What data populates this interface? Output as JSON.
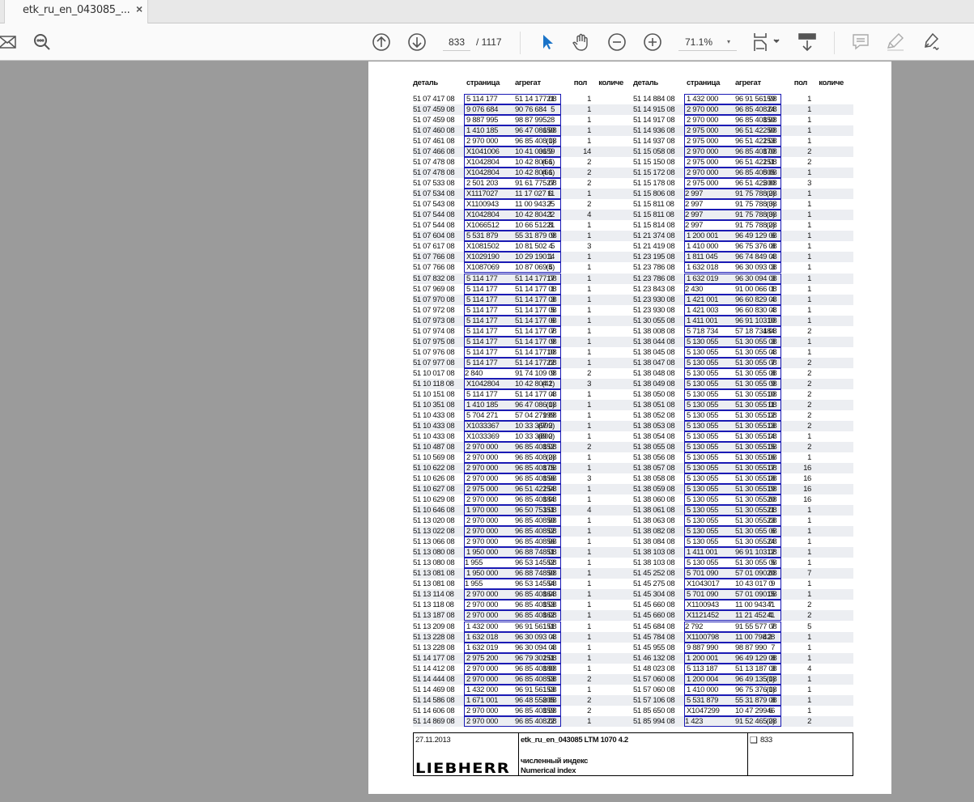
{
  "tab": {
    "title": "etk_ru_en_043085_...",
    "close": "×"
  },
  "toolbar": {
    "page_current": "833",
    "page_total": "/ 1117",
    "zoom": "71.1%",
    "zoom_dropdown": "▾",
    "icons": [
      "mail-icon",
      "search-icon",
      "page-up-icon",
      "page-down-icon",
      "select-cursor-icon",
      "hand-icon",
      "zoom-out-icon",
      "zoom-in-icon",
      "fit-page-icon",
      "scroll-mode-icon",
      "comment-icon",
      "highlight-icon",
      "sign-icon"
    ]
  },
  "colors": {
    "accent": "#1a73c8",
    "box": "#1a1ab4",
    "row_shade": "#eceef2"
  },
  "table": {
    "headers": [
      "деталь",
      "страница",
      "агрегат",
      "пол",
      "количе"
    ],
    "left": [
      [
        "51 07 417 08",
        "5 114 177",
        "51 14 177 08",
        "21",
        "1"
      ],
      [
        "51 07 459 08",
        "9 076 684",
        "90 76 684",
        "5",
        "1"
      ],
      [
        "51 07 459 08",
        "9 887 995",
        "98 87 995",
        "28",
        "1"
      ],
      [
        "51 07 460 08",
        "1 410 185",
        "96 47 086 08",
        "150",
        "1"
      ],
      [
        "51 07 461 08",
        "2 970 000",
        "96 85 408 08",
        "(1)",
        "1"
      ],
      [
        "51 07 466 08",
        "X1041006",
        "10 41 006 9",
        "3159",
        "14"
      ],
      [
        "51 07 478 08",
        "X1042804",
        "10 42 804 1",
        "(66)",
        "2"
      ],
      [
        "51 07 478 08",
        "X1042804",
        "10 42 804 1",
        "(66)",
        "2"
      ],
      [
        "51 07 533 08",
        "2 501 203",
        "91 61 775 08",
        "27",
        "2"
      ],
      [
        "51 07 534 08",
        "X1117027",
        "11 17 027 6",
        "11",
        "1"
      ],
      [
        "51 07 543 08",
        "X1100943",
        "11 00 943 7",
        "25",
        "2"
      ],
      [
        "51 07 544 08",
        "X1042804",
        "10 42 804 1",
        "22",
        "4"
      ],
      [
        "51 07 544 08",
        "X1066512",
        "10 66 512 8",
        "21",
        "1"
      ],
      [
        "51 07 604 08",
        "5 531 879",
        "55 31 879 08",
        "9",
        "1"
      ],
      [
        "51 07 617 08",
        "X1081502",
        "10 81 502 4",
        "5",
        "3"
      ],
      [
        "51 07 766 08",
        "X1029190",
        "10 29 190 1",
        "14",
        "1"
      ],
      [
        "51 07 766 08",
        "X1087069",
        "10 87 069 4",
        "(5)",
        "1"
      ],
      [
        "51 07 832 08",
        "5 114 177",
        "51 14 177 08",
        "17",
        "1"
      ],
      [
        "51 07 969 08",
        "5 114 177",
        "51 14 177 08",
        "1",
        "1"
      ],
      [
        "51 07 970 08",
        "5 114 177",
        "51 14 177 08",
        "3",
        "1"
      ],
      [
        "51 07 972 08",
        "5 114 177",
        "51 14 177 08",
        "5",
        "1"
      ],
      [
        "51 07 973 08",
        "5 114 177",
        "51 14 177 08",
        "6",
        "1"
      ],
      [
        "51 07 974 08",
        "5 114 177",
        "51 14 177 08",
        "7",
        "1"
      ],
      [
        "51 07 975 08",
        "5 114 177",
        "51 14 177 08",
        "9",
        "1"
      ],
      [
        "51 07 976 08",
        "5 114 177",
        "51 14 177 08",
        "10",
        "1"
      ],
      [
        "51 07 977 08",
        "5 114 177",
        "51 14 177 08",
        "22",
        "1"
      ],
      [
        "51 10 017 08",
        "2 840",
        "91 74 109 08",
        "9",
        "2"
      ],
      [
        "51 10 118 08",
        "X1042804",
        "10 42 804 1",
        "(42)",
        "3"
      ],
      [
        "51 10 151 08",
        "5 114 177",
        "51 14 177 08",
        "4",
        "1"
      ],
      [
        "51 10 351 08",
        "1 410 185",
        "96 47 086 08",
        "(1)",
        "1"
      ],
      [
        "51 10 433 08",
        "5 704 271",
        "57 04 271 08",
        "999",
        "1"
      ],
      [
        "51 10 433 08",
        "X1033367",
        "10 33 367 2",
        "(999)",
        "1"
      ],
      [
        "51 10 433 08",
        "X1033369",
        "10 33 369 2",
        "(800)",
        "1"
      ],
      [
        "51 10 487 08",
        "2 970 000",
        "96 85 408 08",
        "152",
        "2"
      ],
      [
        "51 10 569 08",
        "2 970 000",
        "96 85 408 08",
        "(2)",
        "1"
      ],
      [
        "51 10 622 08",
        "2 970 000",
        "96 85 408 08",
        "175",
        "1"
      ],
      [
        "51 10 626 08",
        "2 970 000",
        "96 85 408 08",
        "156",
        "3"
      ],
      [
        "51 10 627 08",
        "2 975 000",
        "96 51 422 08",
        "154",
        "1"
      ],
      [
        "51 10 629 08",
        "2 970 000",
        "96 85 408 08",
        "184",
        "1"
      ],
      [
        "51 10 646 08",
        "1 970 000",
        "96 50 753 08",
        "151",
        "4"
      ],
      [
        "51 13 020 08",
        "2 970 000",
        "96 85 408 08",
        "50",
        "1"
      ],
      [
        "51 13 022 08",
        "2 970 000",
        "96 85 408 08",
        "52",
        "1"
      ],
      [
        "51 13 066 08",
        "2 970 000",
        "96 85 408 08",
        "56",
        "1"
      ],
      [
        "51 13 080 08",
        "1 950 000",
        "96 88 748 08",
        "51",
        "1"
      ],
      [
        "51 13 080 08",
        "1 955",
        "96 53 145 08",
        "52",
        "1"
      ],
      [
        "51 13 081 08",
        "1 950 000",
        "96 88 748 08",
        "50",
        "1"
      ],
      [
        "51 13 081 08",
        "1 955",
        "96 53 145 08",
        "54",
        "1"
      ],
      [
        "51 13 114 08",
        "2 970 000",
        "96 85 408 08",
        "164",
        "1"
      ],
      [
        "51 13 118 08",
        "2 970 000",
        "96 85 408 08",
        "153",
        "1"
      ],
      [
        "51 13 187 08",
        "2 970 000",
        "96 85 408 08",
        "162",
        "1"
      ],
      [
        "51 13 209 08",
        "1 432 000",
        "96 91 561 08",
        "151",
        "1"
      ],
      [
        "51 13 228 08",
        "1 632 018",
        "96 30 093 08",
        "4",
        "1"
      ],
      [
        "51 13 228 08",
        "1 632 019",
        "96 30 094 08",
        "4",
        "1"
      ],
      [
        "51 14 177 08",
        "2 975 200",
        "96 79 302 08",
        "151",
        "1"
      ],
      [
        "51 14 412 08",
        "2 970 000",
        "96 85 408 08",
        "180",
        "1"
      ],
      [
        "51 14 444 08",
        "2 970 000",
        "96 85 408 08",
        "53",
        "2"
      ],
      [
        "51 14 469 08",
        "1 432 000",
        "96 91 561 08",
        "153",
        "1"
      ],
      [
        "51 14 586 08",
        "1 671 001",
        "96 48 558 08",
        "205",
        "2"
      ],
      [
        "51 14 606 08",
        "2 970 000",
        "96 85 408 08",
        "159",
        "2"
      ],
      [
        "51 14 869 08",
        "2 970 000",
        "96 85 408 08",
        "22",
        "1"
      ]
    ],
    "right": [
      [
        "51 14 884 08",
        "1 432 000",
        "96 91 561 08",
        "159",
        "1"
      ],
      [
        "51 14 915 08",
        "2 970 000",
        "96 85 408 08",
        "24",
        "1"
      ],
      [
        "51 14 917 08",
        "2 970 000",
        "96 85 408 08",
        "150",
        "1"
      ],
      [
        "51 14 936 08",
        "2 975 000",
        "96 51 422 08",
        "50",
        "1"
      ],
      [
        "51 14 937 08",
        "2 975 000",
        "96 51 422 08",
        "153",
        "1"
      ],
      [
        "51 15 058 08",
        "2 970 000",
        "96 85 408 08",
        "170",
        "2"
      ],
      [
        "51 15 150 08",
        "2 975 000",
        "96 51 422 08",
        "151",
        "2"
      ],
      [
        "51 15 172 08",
        "2 970 000",
        "96 85 408 08",
        "505",
        "1"
      ],
      [
        "51 15 178 08",
        "2 975 000",
        "96 51 422 08",
        "500",
        "3"
      ],
      [
        "51 15 806 08",
        "2 997",
        "91 75 788 08",
        "(2)",
        "1"
      ],
      [
        "51 15 811 08",
        "2 997",
        "91 75 788 08",
        "(3)",
        "1"
      ],
      [
        "51 15 811 08",
        "2 997",
        "91 75 788 08",
        "(3)",
        "1"
      ],
      [
        "51 15 814 08",
        "2 997",
        "91 75 788 08",
        "(2)",
        "1"
      ],
      [
        "51 21 374 08",
        "1 200 001",
        "96 49 129 08",
        "6",
        "1"
      ],
      [
        "51 21 419 08",
        "1 410 000",
        "96 75 376 08",
        "8",
        "1"
      ],
      [
        "51 23 195 08",
        "1 811 045",
        "96 74 849 08",
        "4",
        "1"
      ],
      [
        "51 23 786 08",
        "1 632 018",
        "96 30 093 08",
        "3",
        "1"
      ],
      [
        "51 23 786 08",
        "1 632 019",
        "96 30 094 08",
        "3",
        "1"
      ],
      [
        "51 23 843 08",
        "2 430",
        "91 00 066 08",
        "1",
        "1"
      ],
      [
        "51 23 930 08",
        "1 421 001",
        "96 60 829 08",
        "4",
        "1"
      ],
      [
        "51 23 930 08",
        "1 421 003",
        "96 60 830 08",
        "4",
        "1"
      ],
      [
        "51 30 055 08",
        "1 411 001",
        "96 91 103 08",
        "10",
        "1"
      ],
      [
        "51 38 008 08",
        "5 718 734",
        "57 18 734 08",
        "184",
        "2"
      ],
      [
        "51 38 044 08",
        "5 130 055",
        "51 30 055 08",
        "3",
        "1"
      ],
      [
        "51 38 045 08",
        "5 130 055",
        "51 30 055 08",
        "4",
        "1"
      ],
      [
        "51 38 047 08",
        "5 130 055",
        "51 30 055 08",
        "7",
        "2"
      ],
      [
        "51 38 048 08",
        "5 130 055",
        "51 30 055 08",
        "8",
        "2"
      ],
      [
        "51 38 049 08",
        "5 130 055",
        "51 30 055 08",
        "9",
        "2"
      ],
      [
        "51 38 050 08",
        "5 130 055",
        "51 30 055 08",
        "10",
        "2"
      ],
      [
        "51 38 051 08",
        "5 130 055",
        "51 30 055 08",
        "11",
        "2"
      ],
      [
        "51 38 052 08",
        "5 130 055",
        "51 30 055 08",
        "12",
        "2"
      ],
      [
        "51 38 053 08",
        "5 130 055",
        "51 30 055 08",
        "13",
        "2"
      ],
      [
        "51 38 054 08",
        "5 130 055",
        "51 30 055 08",
        "14",
        "1"
      ],
      [
        "51 38 055 08",
        "5 130 055",
        "51 30 055 08",
        "15",
        "2"
      ],
      [
        "51 38 056 08",
        "5 130 055",
        "51 30 055 08",
        "16",
        "1"
      ],
      [
        "51 38 057 08",
        "5 130 055",
        "51 30 055 08",
        "17",
        "16"
      ],
      [
        "51 38 058 08",
        "5 130 055",
        "51 30 055 08",
        "18",
        "16"
      ],
      [
        "51 38 059 08",
        "5 130 055",
        "51 30 055 08",
        "19",
        "16"
      ],
      [
        "51 38 060 08",
        "5 130 055",
        "51 30 055 08",
        "20",
        "16"
      ],
      [
        "51 38 061 08",
        "5 130 055",
        "51 30 055 08",
        "21",
        "1"
      ],
      [
        "51 38 063 08",
        "5 130 055",
        "51 30 055 08",
        "23",
        "1"
      ],
      [
        "51 38 082 08",
        "5 130 055",
        "51 30 055 08",
        "6",
        "1"
      ],
      [
        "51 38 084 08",
        "5 130 055",
        "51 30 055 08",
        "24",
        "1"
      ],
      [
        "51 38 103 08",
        "1 411 001",
        "96 91 103 08",
        "12",
        "1"
      ],
      [
        "51 38 103 08",
        "5 130 055",
        "51 30 055 08",
        "5",
        "1"
      ],
      [
        "51 45 252 08",
        "5 701 090",
        "57 01 090 08",
        "20",
        "7"
      ],
      [
        "51 45 275 08",
        "X1043017",
        "10 43 017 0",
        "9",
        "1"
      ],
      [
        "51 45 304 08",
        "5 701 090",
        "57 01 090 08",
        "15",
        "1"
      ],
      [
        "51 45 660 08",
        "X1100943",
        "11 00 943 7",
        "41",
        "2"
      ],
      [
        "51 45 660 08",
        "X1121452",
        "11 21 452 4",
        "41",
        "2"
      ],
      [
        "51 45 684 08",
        "2 792",
        "91 55 577 08",
        "7",
        "5"
      ],
      [
        "51 45 784 08",
        "X1100798",
        "11 00 798 2",
        "428",
        "1"
      ],
      [
        "51 45 955 08",
        "9 887 990",
        "98 87 990",
        "7",
        "1"
      ],
      [
        "51 46 132 08",
        "1 200 001",
        "96 49 129 08",
        "8",
        "1"
      ],
      [
        "51 48 023 08",
        "5 113 187",
        "51 13 187 08",
        "3",
        "4"
      ],
      [
        "51 57 060 08",
        "1 200 004",
        "96 49 135 08",
        "(1)",
        "1"
      ],
      [
        "51 57 060 08",
        "1 410 000",
        "96 75 376 08",
        "(1)",
        "1"
      ],
      [
        "51 57 106 08",
        "5 531 879",
        "55 31 879 08",
        "8",
        "1"
      ],
      [
        "51 85 650 08",
        "X1047299",
        "10 47 299 6",
        "46",
        "1"
      ],
      [
        "51 85 994 08",
        "1 423",
        "91 52 465 08",
        "(2)",
        "2"
      ]
    ]
  },
  "footer": {
    "date": "27.11.2013",
    "doc": "etk_ru_en_043085 LTM 1070 4.2",
    "title_ru": "численный индекс",
    "title_en": "Numerical index",
    "page_icon": "❑",
    "page": "833",
    "logo": "LIEBHERR"
  }
}
